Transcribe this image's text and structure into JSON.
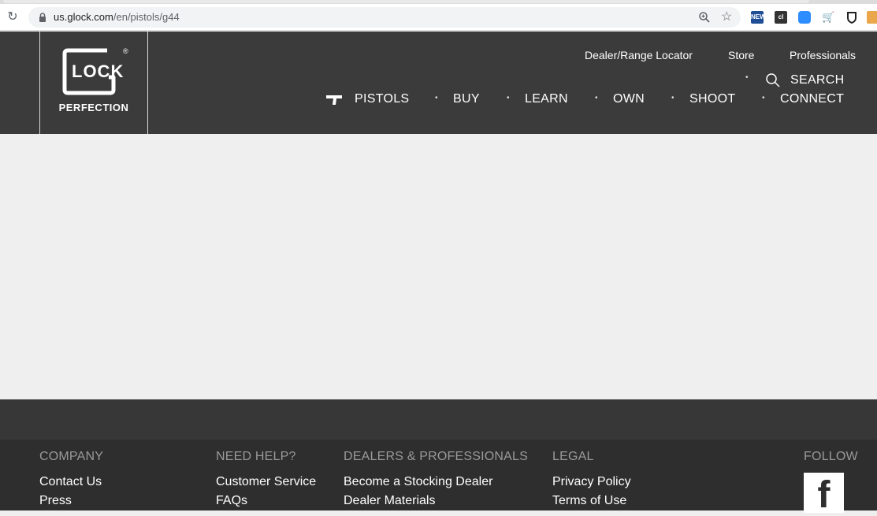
{
  "browser": {
    "url_host": "us.glock.com",
    "url_path": "/en/pistols/g44",
    "ext_new_label": "NEW",
    "ext_cl_label": "cl"
  },
  "header": {
    "logo_text": "LOCK",
    "logo_tagline": "PERFECTION",
    "logo_reg": "®",
    "utility_links": [
      "Dealer/Range Locator",
      "Store",
      "Professionals"
    ],
    "search_label": "SEARCH",
    "nav": [
      "PISTOLS",
      "BUY",
      "LEARN",
      "OWN",
      "SHOOT",
      "CONNECT"
    ]
  },
  "footer": {
    "company": {
      "heading": "COMPANY",
      "links": [
        "Contact Us",
        "Press"
      ]
    },
    "help": {
      "heading": "NEED HELP?",
      "links": [
        "Customer Service",
        "FAQs"
      ]
    },
    "dealers": {
      "heading": "DEALERS & PROFESSIONALS",
      "links": [
        "Become a Stocking Dealer",
        "Dealer Materials"
      ]
    },
    "legal": {
      "heading": "LEGAL",
      "links": [
        "Privacy Policy",
        "Terms of Use"
      ]
    },
    "follow": {
      "heading": "FOLLOW",
      "facebook_glyph": "f"
    }
  },
  "colors": {
    "header_bg": "#3b3b3b",
    "footer_bg": "#2e2e2e",
    "page_bg": "#efefef"
  }
}
